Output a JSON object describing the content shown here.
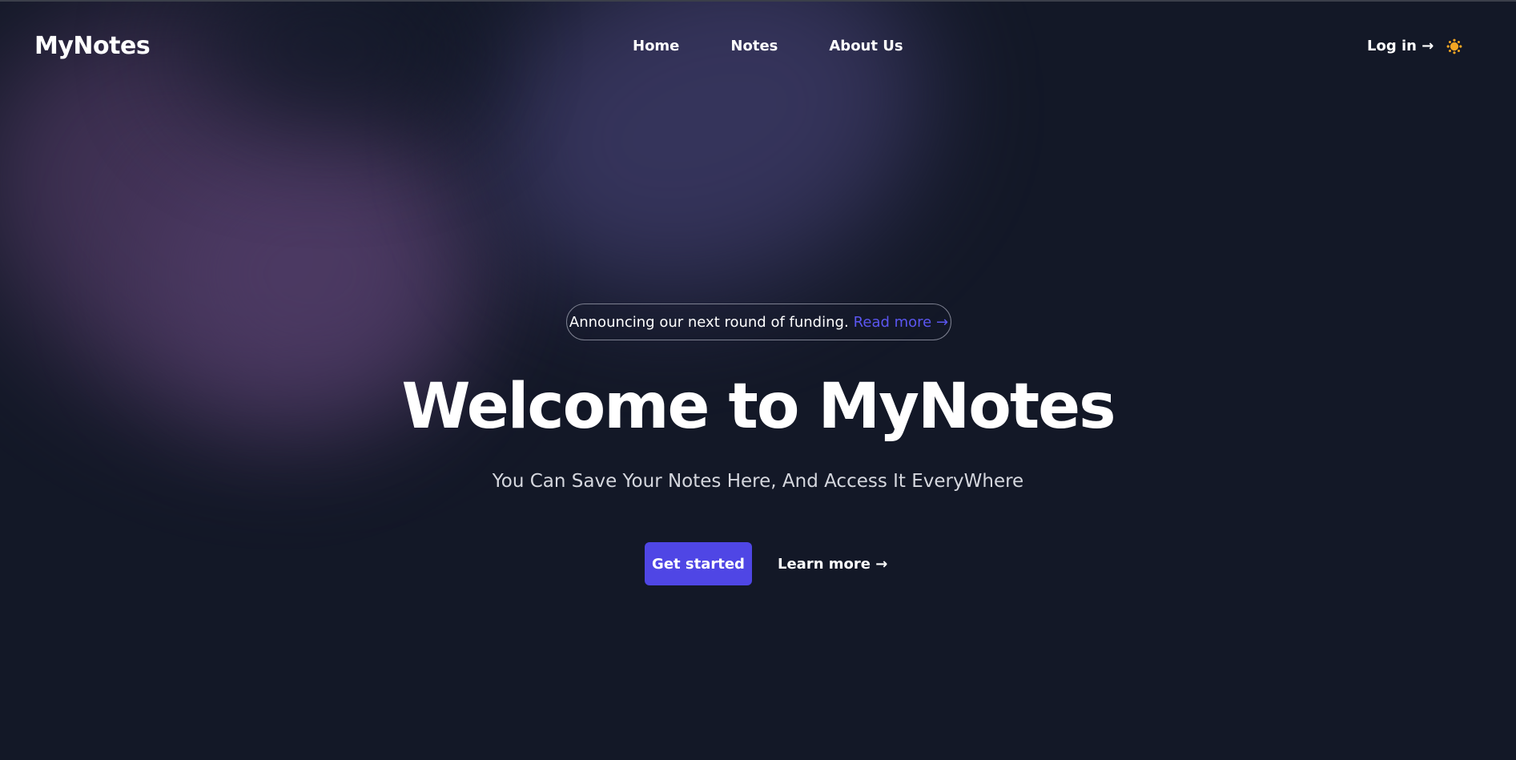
{
  "header": {
    "logo": "MyNotes",
    "nav": [
      {
        "label": "Home"
      },
      {
        "label": "Notes"
      },
      {
        "label": "About Us"
      }
    ],
    "login_label": "Log in →",
    "theme_icon": "sun-icon"
  },
  "hero": {
    "announcement_text": "Announcing our next round of funding.",
    "announcement_link": "Read more →",
    "title": "Welcome to MyNotes",
    "subtitle": "You Can Save Your Notes Here, And Access It EveryWhere",
    "primary_cta": "Get started",
    "secondary_cta": "Learn more →"
  },
  "colors": {
    "background": "#131827",
    "accent": "#4f46e5",
    "link": "#5b56f0",
    "sun": "#f5a623"
  }
}
